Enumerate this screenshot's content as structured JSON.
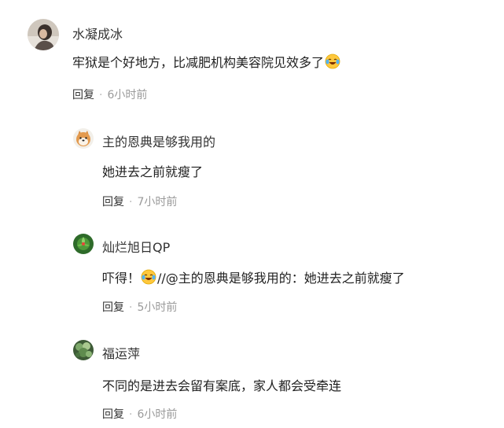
{
  "comments": [
    {
      "user": "水凝成冰",
      "avatar_icon": "avatar-woman-photo-icon",
      "text_before": "牢狱是个好地方，比减肥机构美容院见效多了",
      "emoji": "laughing-crying-emoji-icon",
      "text_after": "",
      "reply_label": "回复",
      "separator": "·",
      "time": "6小时前"
    }
  ],
  "replies": [
    {
      "user": "主的恩典是够我用的",
      "avatar_icon": "avatar-shiba-dog-icon",
      "text_before": "她进去之前就瘦了",
      "reply_label": "回复",
      "separator": "·",
      "time": "7小时前"
    },
    {
      "user": "灿烂旭日QP",
      "avatar_icon": "avatar-green-plant-icon",
      "text_before": "吓得！",
      "emoji": "laughing-crying-emoji-icon",
      "text_after": "//@主的恩典是够我用的：她进去之前就瘦了",
      "reply_label": "回复",
      "separator": "·",
      "time": "5小时前"
    },
    {
      "user": "福运萍",
      "avatar_icon": "avatar-green-leaves-icon",
      "text_before": "不同的是进去会留有案底，家人都会受牵连",
      "reply_label": "回复",
      "separator": "·",
      "time": "6小时前"
    }
  ],
  "colors": {
    "text": "#222222",
    "meta": "#9a9a9a",
    "reply": "#333333"
  }
}
